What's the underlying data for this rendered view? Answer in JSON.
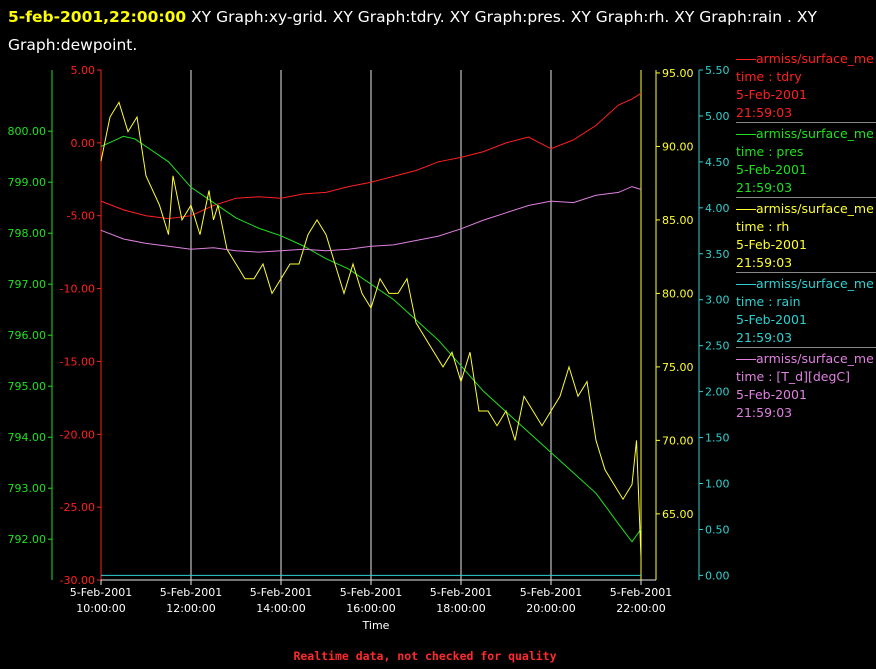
{
  "header": {
    "timestamp": "5-feb-2001,22:00:00",
    "graphs": " XY Graph:xy-grid.  XY Graph:tdry.  XY Graph:pres.  XY Graph:rh.  XY Graph:rain .  XY Graph:dewpoint."
  },
  "footer": "Realtime data, not checked for quality",
  "legend": [
    {
      "source": "armiss/surface_me",
      "var": "time : tdry",
      "date": "5-Feb-2001",
      "time": "21:59:03",
      "color": "#ff2020"
    },
    {
      "source": "armiss/surface_me",
      "var": "time : pres",
      "date": "5-Feb-2001",
      "time": "21:59:03",
      "color": "#20e020"
    },
    {
      "source": "armiss/surface_me",
      "var": "time : rh",
      "date": "5-Feb-2001",
      "time": "21:59:03",
      "color": "#ffff30"
    },
    {
      "source": "armiss/surface_me",
      "var": "time : rain",
      "date": "5-Feb-2001",
      "time": "21:59:03",
      "color": "#30d0d0"
    },
    {
      "source": "armiss/surface_me",
      "var": "time : [T_d][degC]",
      "date": "5-Feb-2001",
      "time": "21:59:03",
      "color": "#e080e0"
    }
  ],
  "chart_data": {
    "type": "line",
    "xlabel": "Time",
    "xlim": [
      10,
      22
    ],
    "x_ticks": [
      {
        "value": 10,
        "date": "5-Feb-2001",
        "time": "10:00:00"
      },
      {
        "value": 12,
        "date": "5-Feb-2001",
        "time": "12:00:00"
      },
      {
        "value": 14,
        "date": "5-Feb-2001",
        "time": "14:00:00"
      },
      {
        "value": 16,
        "date": "5-Feb-2001",
        "time": "16:00:00"
      },
      {
        "value": 18,
        "date": "5-Feb-2001",
        "time": "18:00:00"
      },
      {
        "value": 20,
        "date": "5-Feb-2001",
        "time": "20:00:00"
      },
      {
        "value": 22,
        "date": "5-Feb-2001",
        "time": "22:00:00"
      }
    ],
    "grid": "vertical",
    "axes": {
      "pres": {
        "ylim": [
          791.2,
          801.2
        ],
        "ticks": [
          "792.00",
          "793.00",
          "794.00",
          "795.00",
          "796.00",
          "797.00",
          "798.00",
          "799.00",
          "800.00"
        ],
        "color": "#20e020"
      },
      "tdry": {
        "ylim": [
          -30,
          5
        ],
        "ticks": [
          "-30.00",
          "-25.00",
          "-20.00",
          "-15.00",
          "-10.00",
          "-5.00",
          "0.00",
          "5.00"
        ],
        "color": "#ff2020"
      },
      "rh": {
        "ylim": [
          60.5,
          95.2
        ],
        "ticks": [
          "65.00",
          "70.00",
          "75.00",
          "80.00",
          "85.00",
          "90.00",
          "95.00"
        ],
        "color": "#ffff30"
      },
      "rain": {
        "ylim": [
          -0.05,
          5.5
        ],
        "ticks": [
          "0.00",
          "0.50",
          "1.00",
          "1.50",
          "2.00",
          "2.50",
          "3.00",
          "3.50",
          "4.00",
          "4.50",
          "5.00",
          "5.50"
        ],
        "color": "#30d0d0"
      }
    },
    "series": [
      {
        "name": "time : tdry",
        "axis": "tdry",
        "color": "#ff2020",
        "x": [
          10.0,
          10.5,
          11.0,
          11.5,
          12.0,
          12.5,
          13.0,
          13.5,
          14.0,
          14.5,
          15.0,
          15.5,
          16.0,
          16.5,
          17.0,
          17.5,
          18.0,
          18.5,
          19.0,
          19.5,
          20.0,
          20.5,
          21.0,
          21.5,
          21.8,
          22.0
        ],
        "y": [
          -4.0,
          -4.6,
          -5.0,
          -5.2,
          -5.0,
          -4.3,
          -3.8,
          -3.7,
          -3.8,
          -3.5,
          -3.4,
          -3.0,
          -2.7,
          -2.3,
          -1.9,
          -1.3,
          -1.0,
          -0.6,
          0.0,
          0.4,
          -0.4,
          0.2,
          1.2,
          2.6,
          3.0,
          3.4
        ]
      },
      {
        "name": "time : pres",
        "axis": "pres",
        "color": "#20e020",
        "x": [
          10.0,
          10.25,
          10.5,
          10.75,
          11.0,
          11.5,
          12.0,
          12.5,
          13.0,
          13.5,
          14.0,
          14.5,
          15.0,
          15.5,
          16.0,
          16.5,
          17.0,
          17.5,
          18.0,
          18.5,
          19.0,
          19.5,
          20.0,
          20.5,
          21.0,
          21.5,
          21.8,
          22.0
        ],
        "y": [
          799.7,
          799.8,
          799.9,
          799.85,
          799.7,
          799.4,
          798.9,
          798.6,
          798.3,
          798.1,
          797.95,
          797.75,
          797.5,
          797.3,
          797.0,
          796.7,
          796.3,
          795.9,
          795.4,
          794.9,
          794.5,
          794.1,
          793.7,
          793.3,
          792.9,
          792.3,
          791.95,
          792.2
        ]
      },
      {
        "name": "time : rh",
        "axis": "rh",
        "color": "#ffff30",
        "x": [
          10.0,
          10.2,
          10.4,
          10.6,
          10.8,
          11.0,
          11.3,
          11.5,
          11.6,
          11.8,
          12.0,
          12.2,
          12.4,
          12.5,
          12.6,
          12.8,
          13.0,
          13.2,
          13.4,
          13.6,
          13.8,
          14.0,
          14.2,
          14.4,
          14.6,
          14.8,
          15.0,
          15.2,
          15.4,
          15.6,
          15.8,
          16.0,
          16.2,
          16.4,
          16.6,
          16.8,
          17.0,
          17.2,
          17.4,
          17.6,
          17.8,
          18.0,
          18.2,
          18.4,
          18.6,
          18.8,
          19.0,
          19.2,
          19.4,
          19.6,
          19.8,
          20.0,
          20.2,
          20.4,
          20.6,
          20.8,
          21.0,
          21.2,
          21.4,
          21.6,
          21.8,
          21.9,
          22.0
        ],
        "y": [
          89,
          92,
          93,
          91,
          92,
          88,
          86,
          84,
          88,
          85,
          86,
          84,
          87,
          85,
          86,
          83,
          82,
          81,
          81,
          82,
          80,
          81,
          82,
          82,
          84,
          85,
          84,
          82,
          80,
          82,
          80,
          79,
          81,
          80,
          80,
          81,
          78,
          77,
          76,
          75,
          76,
          74,
          76,
          72,
          72,
          71,
          72,
          70,
          73,
          72,
          71,
          72,
          73,
          75,
          73,
          74,
          70,
          68,
          67,
          66,
          67,
          70,
          62
        ]
      },
      {
        "name": "time : rain",
        "axis": "rain",
        "color": "#30d0d0",
        "x": [
          10.0,
          22.0
        ],
        "y": [
          0.0,
          0.0
        ]
      },
      {
        "name": "time : [T_d][degC]",
        "axis": "tdry",
        "color": "#e080e0",
        "x": [
          10.0,
          10.5,
          11.0,
          11.5,
          12.0,
          12.5,
          13.0,
          13.5,
          14.0,
          14.5,
          15.0,
          15.5,
          16.0,
          16.5,
          17.0,
          17.5,
          18.0,
          18.5,
          19.0,
          19.5,
          20.0,
          20.5,
          21.0,
          21.5,
          21.8,
          22.0
        ],
        "y": [
          -6.0,
          -6.6,
          -6.9,
          -7.1,
          -7.3,
          -7.2,
          -7.4,
          -7.5,
          -7.4,
          -7.3,
          -7.4,
          -7.3,
          -7.1,
          -7.0,
          -6.7,
          -6.4,
          -5.9,
          -5.3,
          -4.8,
          -4.3,
          -4.0,
          -4.1,
          -3.6,
          -3.4,
          -3.0,
          -3.2
        ]
      }
    ]
  }
}
